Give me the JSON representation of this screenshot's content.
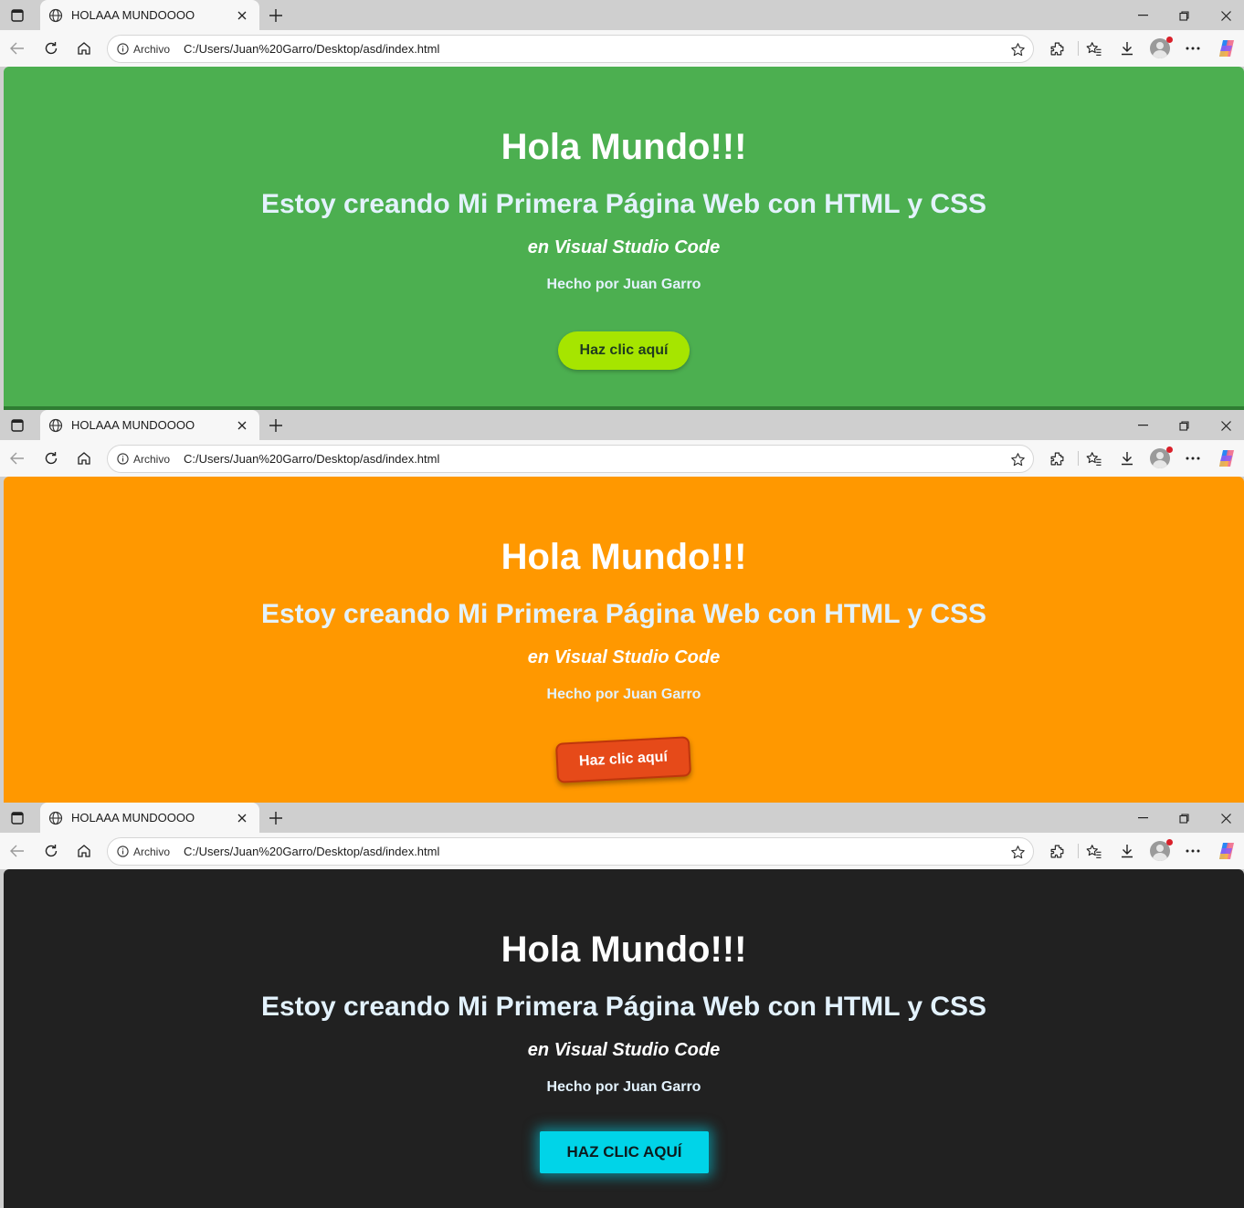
{
  "browser": {
    "tab_title": "HOLAAA MUNDOOOO",
    "address": {
      "scheme_label": "Archivo",
      "url": "C:/Users/Juan%20Garro/Desktop/asd/index.html"
    },
    "icons": [
      "tab-actions-icon",
      "globe-icon",
      "close-icon",
      "plus-icon",
      "minimize-icon",
      "restore-icon",
      "close-window-icon",
      "back-icon",
      "reload-icon",
      "home-icon",
      "info-icon",
      "star-icon",
      "extensions-icon",
      "favorites-icon",
      "download-icon",
      "profile-icon",
      "more-icon",
      "copilot-icon"
    ]
  },
  "page": {
    "heading": "Hola Mundo!!!",
    "subheading": "Estoy creando Mi Primera Página Web con HTML y CSS",
    "tagline": "en Visual Studio Code",
    "credit": "Hecho por Juan Garro"
  },
  "themes": [
    {
      "name": "green",
      "background": "#4caf50",
      "button_label": "Haz clic aquí",
      "button_color": "#a6e500"
    },
    {
      "name": "orange",
      "background": "#ff9800",
      "button_label": "Haz clic aquí",
      "button_color": "#e64a19"
    },
    {
      "name": "dark",
      "background": "#212121",
      "button_label": "HAZ CLIC AQUÍ",
      "button_color": "#00d4e8"
    }
  ]
}
